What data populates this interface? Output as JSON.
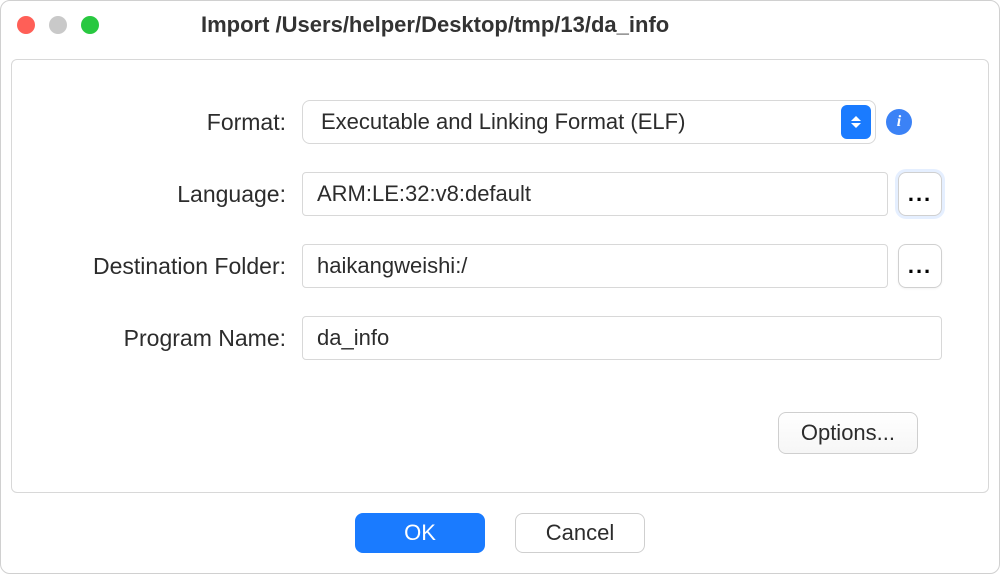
{
  "window": {
    "title": "Import /Users/helper/Desktop/tmp/13/da_info"
  },
  "form": {
    "format": {
      "label": "Format:",
      "value": "Executable and Linking Format (ELF)"
    },
    "language": {
      "label": "Language:",
      "value": "ARM:LE:32:v8:default",
      "browse": "..."
    },
    "destination": {
      "label": "Destination Folder:",
      "value": "haikangweishi:/",
      "browse": "..."
    },
    "programName": {
      "label": "Program Name:",
      "value": "da_info"
    },
    "options": "Options..."
  },
  "footer": {
    "ok": "OK",
    "cancel": "Cancel"
  },
  "icons": {
    "info": "i"
  }
}
